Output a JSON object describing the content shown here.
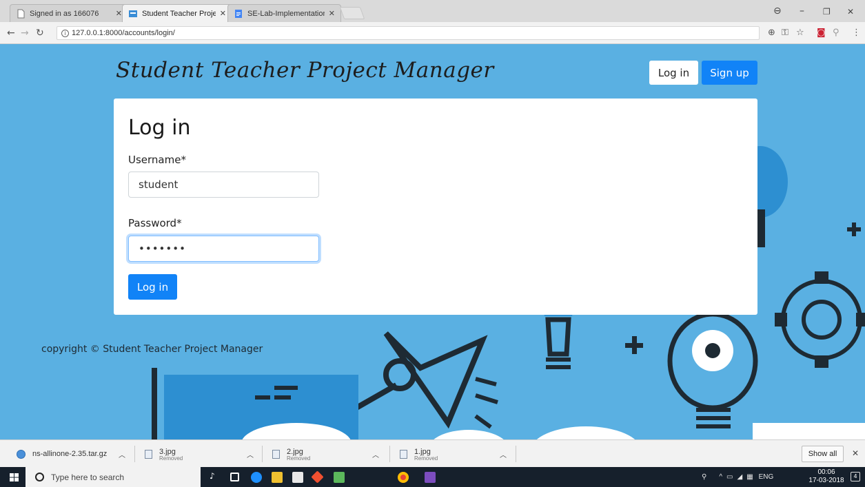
{
  "browser": {
    "tabs": [
      {
        "title": "Signed in as 166076",
        "active": false
      },
      {
        "title": "Student Teacher Project M",
        "active": true
      },
      {
        "title": "SE-Lab-Implementation-",
        "active": false
      }
    ],
    "url": "127.0.0.1:8000/accounts/login/"
  },
  "site": {
    "brand": "Student Teacher Project Manager",
    "nav_login": "Log in",
    "nav_signup": "Sign up",
    "footer": "copyright © Student Teacher Project Manager"
  },
  "login_form": {
    "heading": "Log in",
    "username_label": "Username*",
    "username_value": "student",
    "password_label": "Password*",
    "password_value": "•••••••",
    "submit_label": "Log in"
  },
  "downloads": {
    "items": [
      {
        "name": "ns-allinone-2.35.tar.gz",
        "status": ""
      },
      {
        "name": "3.jpg",
        "status": "Removed"
      },
      {
        "name": "2.jpg",
        "status": "Removed"
      },
      {
        "name": "1.jpg",
        "status": "Removed"
      }
    ],
    "show_all": "Show all"
  },
  "taskbar": {
    "search_placeholder": "Type here to search",
    "language": "ENG",
    "time": "00:06",
    "date": "17-03-2018",
    "notification_count": "4"
  },
  "colors": {
    "page_background": "#5ab0e2",
    "primary_button": "#1183f7",
    "taskbar": "#16202c"
  }
}
